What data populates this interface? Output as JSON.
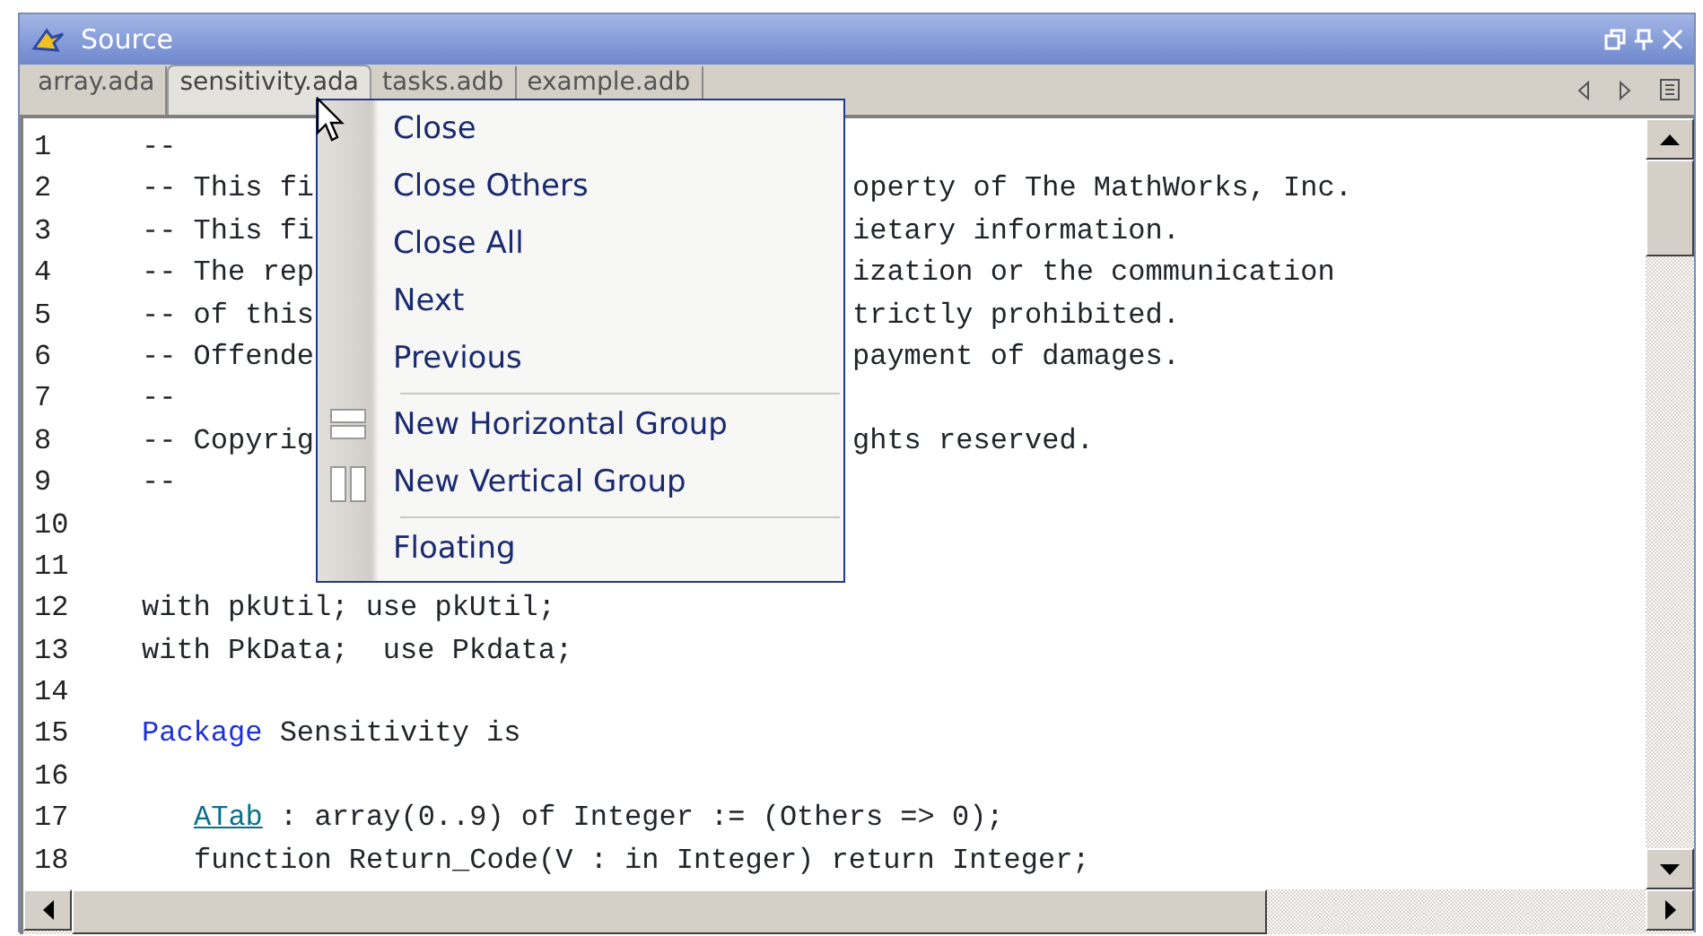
{
  "window": {
    "title": "Source"
  },
  "tabs": [
    {
      "label": "array.ada",
      "selected": false
    },
    {
      "label": "sensitivity.ada",
      "selected": true
    },
    {
      "label": "tasks.adb",
      "selected": false
    },
    {
      "label": "example.adb",
      "selected": false
    }
  ],
  "code_lines": [
    {
      "number": "1",
      "indented": false,
      "segments": [
        {
          "text": "--",
          "kind": "plain"
        }
      ]
    },
    {
      "number": "2",
      "indented": false,
      "segments": [
        {
          "text": "-- This fi",
          "kind": "plain"
        }
      ],
      "tail": "operty of The MathWorks, Inc."
    },
    {
      "number": "3",
      "indented": false,
      "segments": [
        {
          "text": "-- This fi",
          "kind": "plain"
        }
      ],
      "tail": "ietary information."
    },
    {
      "number": "4",
      "indented": false,
      "segments": [
        {
          "text": "-- The rep",
          "kind": "plain"
        }
      ],
      "tail": "ization or the communication"
    },
    {
      "number": "5",
      "indented": false,
      "segments": [
        {
          "text": "-- of this",
          "kind": "plain"
        }
      ],
      "tail": "trictly prohibited."
    },
    {
      "number": "6",
      "indented": false,
      "segments": [
        {
          "text": "-- Offende",
          "kind": "plain"
        }
      ],
      "tail": "payment of damages."
    },
    {
      "number": "7",
      "indented": false,
      "segments": [
        {
          "text": "--",
          "kind": "plain"
        }
      ]
    },
    {
      "number": "8",
      "indented": false,
      "segments": [
        {
          "text": "-- Copyrig",
          "kind": "plain"
        }
      ],
      "tail": "ghts reserved."
    },
    {
      "number": "9",
      "indented": false,
      "segments": [
        {
          "text": "--",
          "kind": "plain"
        }
      ]
    },
    {
      "number": "10"
    },
    {
      "number": "11"
    },
    {
      "number": "12",
      "indented": false,
      "segments": [
        {
          "text": "with pkUtil; use pkUtil;",
          "kind": "plain"
        }
      ]
    },
    {
      "number": "13",
      "indented": false,
      "segments": [
        {
          "text": "with PkData;  use Pkdata;",
          "kind": "plain"
        }
      ]
    },
    {
      "number": "14"
    },
    {
      "number": "15",
      "indented": false,
      "segments": [
        {
          "text": "Package",
          "kind": "keyword"
        },
        {
          "text": " Sensitivity is",
          "kind": "plain"
        }
      ]
    },
    {
      "number": "16"
    },
    {
      "number": "17",
      "indented": true,
      "segments": [
        {
          "text": "ATab",
          "kind": "link"
        },
        {
          "text": " : array(0..9) of Integer := (Others => 0);",
          "kind": "plain"
        }
      ]
    },
    {
      "number": "18",
      "indented": true,
      "segments": [
        {
          "text": "function Return_Code(V : in Integer) return Integer;",
          "kind": "plain"
        }
      ]
    }
  ],
  "context_menu": {
    "items": [
      {
        "label": "Close",
        "kind": "plain",
        "separator_before": false
      },
      {
        "label": "Close Others",
        "kind": "plain",
        "separator_before": false
      },
      {
        "label": "Close All",
        "kind": "plain",
        "separator_before": false
      },
      {
        "label": "Next",
        "kind": "plain",
        "separator_before": false
      },
      {
        "label": "Previous",
        "kind": "plain",
        "separator_before": false
      },
      {
        "label": "New Horizontal Group",
        "kind": "horizontal-split",
        "separator_before": true
      },
      {
        "label": "New Vertical Group",
        "kind": "vertical-split",
        "separator_before": false
      },
      {
        "label": "Floating",
        "kind": "plain",
        "separator_before": true
      }
    ]
  }
}
